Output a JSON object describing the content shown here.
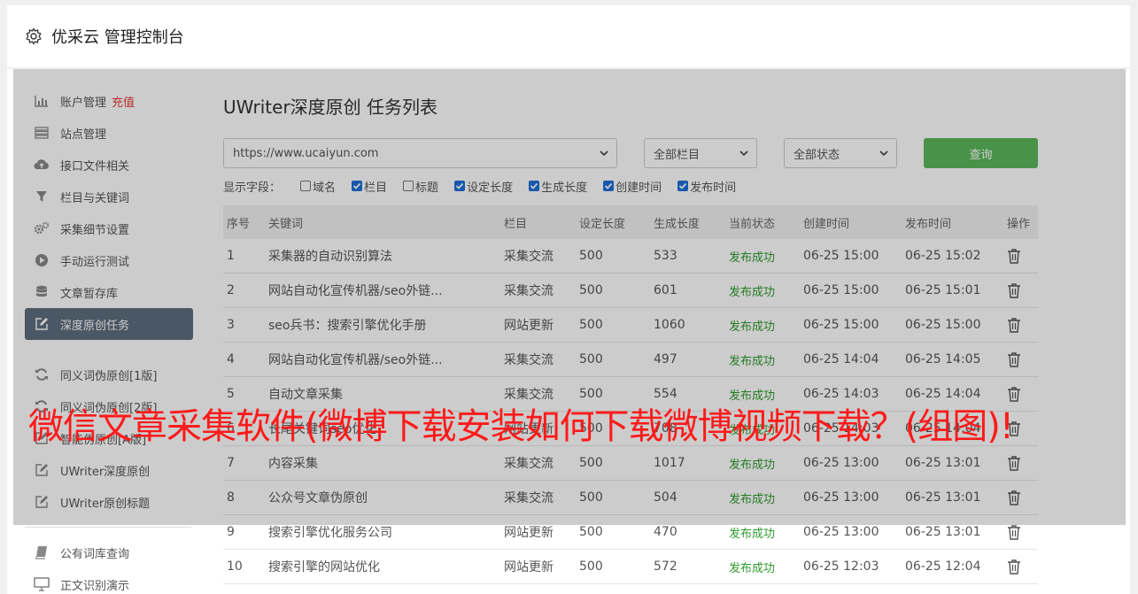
{
  "app": {
    "title": "优采云 管理控制台",
    "icon": "gear-icon"
  },
  "sidebar": {
    "group1": [
      {
        "label": "账户管理",
        "badge": "充值",
        "icon": "bar-chart-icon"
      },
      {
        "label": "站点管理",
        "icon": "server-icon"
      },
      {
        "label": "接口文件相关",
        "icon": "cloud-upload-icon"
      },
      {
        "label": "栏目与关键词",
        "icon": "filter-icon"
      },
      {
        "label": "采集细节设置",
        "icon": "gears-icon"
      },
      {
        "label": "手动运行测试",
        "icon": "play-circle-icon"
      },
      {
        "label": "文章暂存库",
        "icon": "database-icon"
      },
      {
        "label": "深度原创任务",
        "icon": "edit-icon",
        "active": true
      }
    ],
    "group2": [
      {
        "label": "同义词伪原创[1版]",
        "icon": "refresh-icon"
      },
      {
        "label": "同义词伪原创[2版]",
        "icon": "refresh-icon"
      },
      {
        "label": "智能伪原创[A版]",
        "icon": "edit-icon"
      },
      {
        "label": "UWriter深度原创",
        "icon": "edit-icon"
      },
      {
        "label": "UWriter原创标题",
        "icon": "edit-icon"
      }
    ],
    "group3": [
      {
        "label": "公有词库查询",
        "icon": "book-icon"
      },
      {
        "label": "正文识别演示",
        "icon": "monitor-icon"
      }
    ]
  },
  "main": {
    "title": "UWriter深度原创 任务列表",
    "site_select": "https://www.ucaiyun.com",
    "column_select": "全部栏目",
    "status_select": "全部状态",
    "query_button": "查询",
    "fields_label": "显示字段：",
    "fields": [
      {
        "label": "域名",
        "checked": false
      },
      {
        "label": "栏目",
        "checked": true
      },
      {
        "label": "标题",
        "checked": false
      },
      {
        "label": "设定长度",
        "checked": true
      },
      {
        "label": "生成长度",
        "checked": true
      },
      {
        "label": "创建时间",
        "checked": true
      },
      {
        "label": "发布时间",
        "checked": true
      }
    ],
    "headers": [
      "序号",
      "关键词",
      "栏目",
      "设定长度",
      "生成长度",
      "当前状态",
      "创建时间",
      "发布时间",
      "操作"
    ],
    "rows": [
      [
        "1",
        "采集器的自动识别算法",
        "采集交流",
        "500",
        "533",
        "发布成功",
        "06-25 15:00",
        "06-25 15:02"
      ],
      [
        "2",
        "网站自动化宣传机器/seo外链...",
        "采集交流",
        "500",
        "601",
        "发布成功",
        "06-25 15:00",
        "06-25 15:01"
      ],
      [
        "3",
        "seo兵书：搜索引擎优化手册",
        "网站更新",
        "500",
        "1060",
        "发布成功",
        "06-25 15:00",
        "06-25 15:00"
      ],
      [
        "4",
        "网站自动化宣传机器/seo外链...",
        "采集交流",
        "500",
        "497",
        "发布成功",
        "06-25 14:04",
        "06-25 14:05"
      ],
      [
        "5",
        "自动文章采集",
        "采集交流",
        "500",
        "554",
        "发布成功",
        "06-25 14:03",
        "06-25 14:04"
      ],
      [
        "6",
        "长尾关键词seo优化",
        "网站更新",
        "500",
        "708",
        "发布成功",
        "06-25 14:03",
        "06-25 14:04"
      ],
      [
        "7",
        "内容采集",
        "采集交流",
        "500",
        "1017",
        "发布成功",
        "06-25 13:00",
        "06-25 13:01"
      ],
      [
        "8",
        "公众号文章伪原创",
        "采集交流",
        "500",
        "504",
        "发布成功",
        "06-25 13:00",
        "06-25 13:01"
      ],
      [
        "9",
        "搜索引擎优化服务公司",
        "网站更新",
        "500",
        "470",
        "发布成功",
        "06-25 13:00",
        "06-25 13:01"
      ],
      [
        "10",
        "搜索引擎的网站优化",
        "网站更新",
        "500",
        "572",
        "发布成功",
        "06-25 12:03",
        "06-25 12:04"
      ]
    ]
  },
  "banner": "微信文章采集软件(微博下载安装如何下载微博视频下载？(组图)!",
  "colors": {
    "active": "#5d6d7e",
    "success": "#2e9b2e",
    "query": "#5cb85c",
    "banner": "#ff1a1a"
  }
}
